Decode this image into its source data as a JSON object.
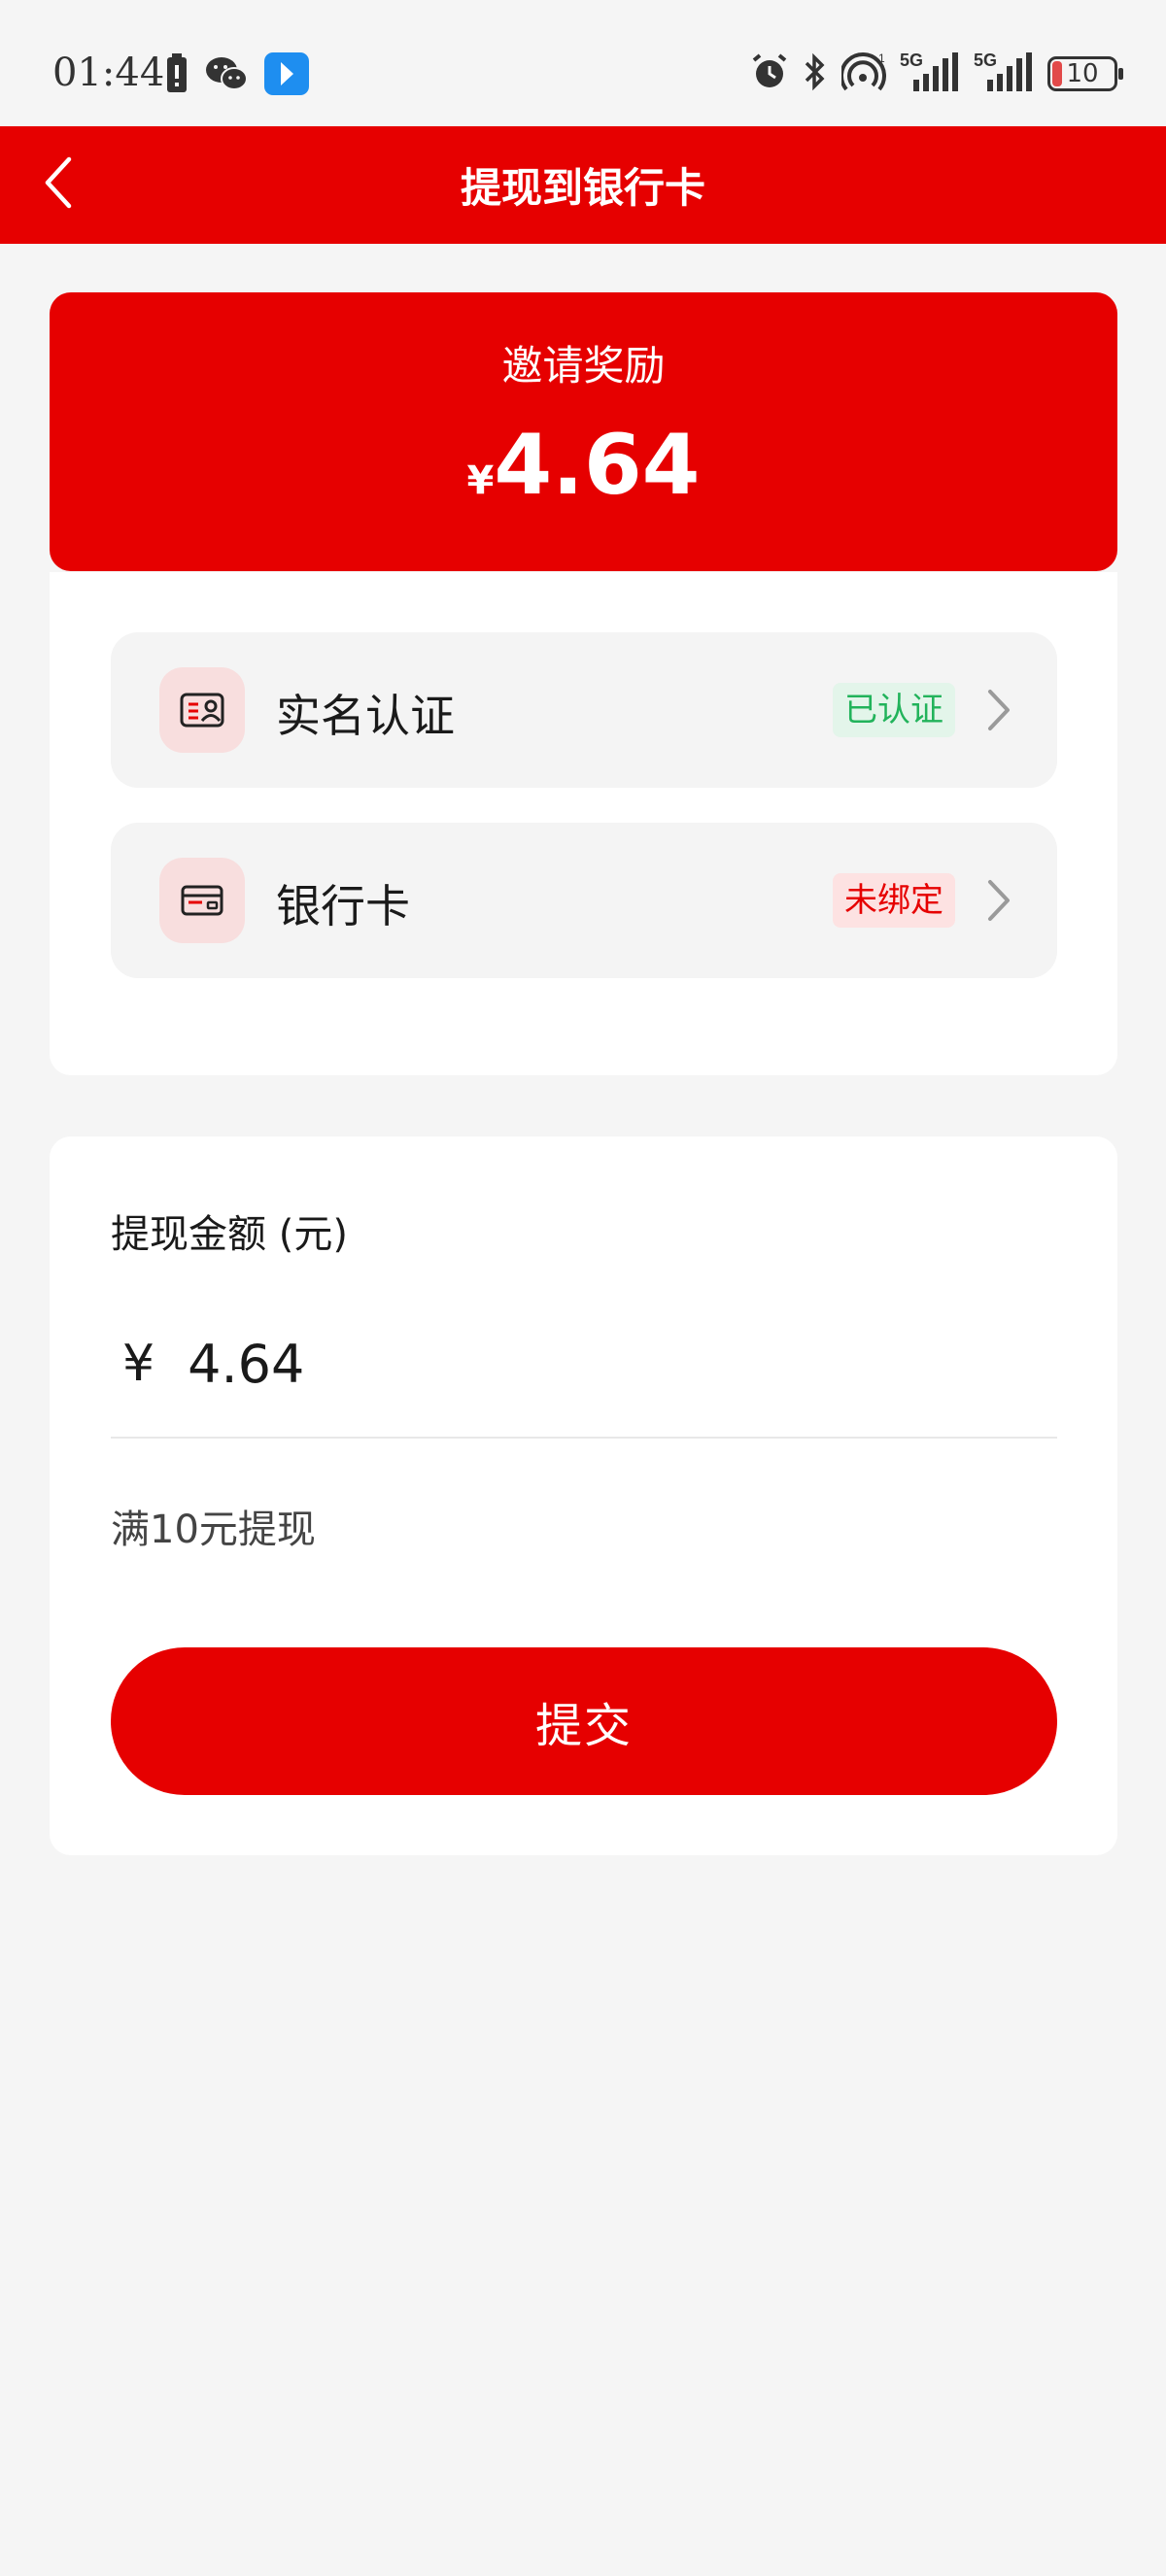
{
  "status_bar": {
    "time": "01:44",
    "battery": "10",
    "left_icons": [
      "battery-alert-icon",
      "wechat-icon",
      "app-icon"
    ],
    "right_icons": [
      "alarm-icon",
      "bluetooth-icon",
      "hotspot-icon",
      "signal-5g-icon",
      "signal-5g-icon"
    ],
    "network_1": "5G",
    "network_2": "5G"
  },
  "header": {
    "title": "提现到银行卡",
    "back_icon": "chevron-left-icon"
  },
  "reward": {
    "label": "邀请奖励",
    "currency": "¥",
    "amount": "4.64"
  },
  "verification": {
    "rows": [
      {
        "label": "实名认证",
        "status": "已认证",
        "icon": "id-card-icon"
      },
      {
        "label": "银行卡",
        "status": "未绑定",
        "icon": "bank-card-icon"
      }
    ]
  },
  "withdraw": {
    "title": "提现金额 (元)",
    "currency": "¥",
    "amount": "4.64",
    "hint": "满10元提现",
    "submit_label": "提交"
  },
  "colors": {
    "brand": "#e60000",
    "verified_text": "#22b35b",
    "verified_bg": "#e3f5ea",
    "unbound_bg": "#fde2e2",
    "page_bg": "#f5f5f5"
  }
}
